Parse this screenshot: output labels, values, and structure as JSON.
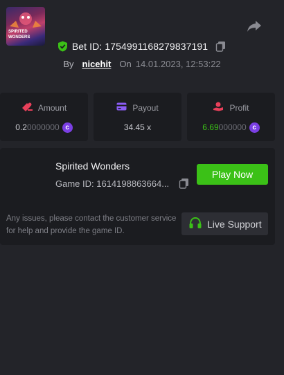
{
  "bet": {
    "id_label": "Bet ID: 1754991168279837191",
    "by_label": "By",
    "user": "nicehit",
    "on_label": "On",
    "date": "14.01.2023, 12:53:22"
  },
  "stats": {
    "amount": {
      "label": "Amount",
      "value_bright": "0.2",
      "value_dim": "0000000",
      "currency_icon": "coin-icon"
    },
    "payout": {
      "label": "Payout",
      "value": "34.45 x"
    },
    "profit": {
      "label": "Profit",
      "value_bright": "6.69",
      "value_dim": "000000",
      "currency_icon": "coin-icon"
    }
  },
  "game": {
    "title": "Spirited Wonders",
    "game_id": "Game ID: 1614198863664...",
    "thumb_line1": "SPIRITED",
    "thumb_line2": "WONDERS",
    "play_label": "Play Now"
  },
  "support": {
    "help_text": "Any issues, please contact the customer service for help and provide the game ID.",
    "live_label": "Live Support"
  },
  "colors": {
    "background": "#232429",
    "card": "#1b1c20",
    "accent_green": "#3bc117",
    "coin_purple": "#7b3fe4",
    "amount_icon": "#e8405a",
    "payout_icon": "#8b5cf6",
    "profit_icon": "#e8405a"
  }
}
